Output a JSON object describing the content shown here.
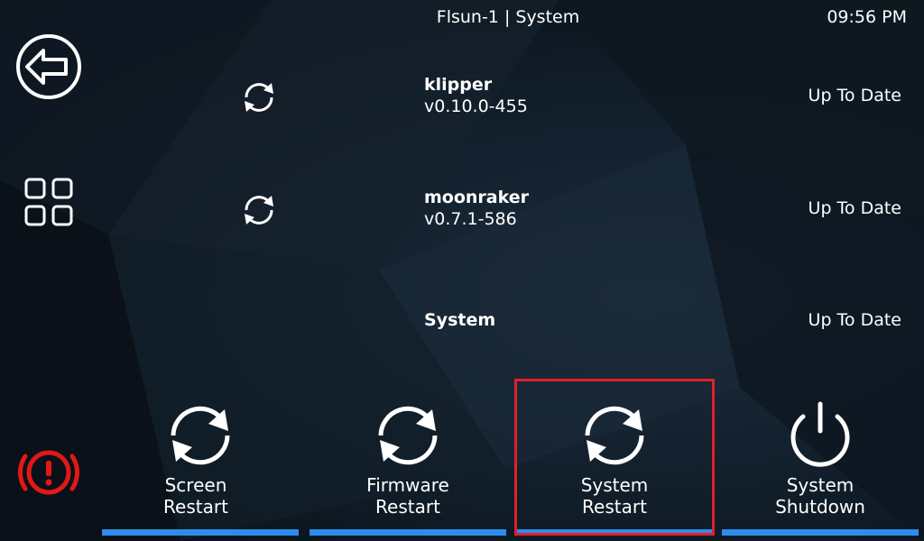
{
  "header": {
    "title": "Flsun-1 | System",
    "time": "09:56 PM"
  },
  "sidebar": {
    "back_icon": "back-arrow-icon",
    "menu_icon": "grid-menu-icon",
    "estop_icon": "emergency-stop-icon"
  },
  "updates": [
    {
      "name": "klipper",
      "version": "v0.10.0-455",
      "status": "Up To Date",
      "icon": "refresh-icon"
    },
    {
      "name": "moonraker",
      "version": "v0.7.1-586",
      "status": "Up To Date",
      "icon": "refresh-icon"
    },
    {
      "name": "System",
      "version": "",
      "status": "Up To Date"
    }
  ],
  "actions": [
    {
      "line1": "Screen",
      "line2": "Restart",
      "icon": "restart-icon"
    },
    {
      "line1": "Firmware",
      "line2": "Restart",
      "icon": "restart-icon"
    },
    {
      "line1": "System",
      "line2": "Restart",
      "icon": "restart-icon"
    },
    {
      "line1": "System",
      "line2": "Shutdown",
      "icon": "power-icon"
    }
  ],
  "colors": {
    "accent": "#2c8ded",
    "highlight": "#e0202a",
    "estop": "#e01818",
    "text": "#ffffff"
  }
}
